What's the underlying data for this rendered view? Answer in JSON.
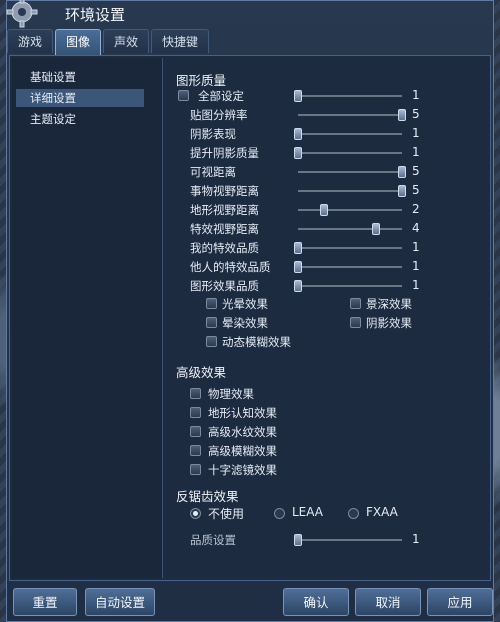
{
  "window": {
    "title": "环境设置"
  },
  "tabs": [
    {
      "label": "游戏",
      "active": false
    },
    {
      "label": "图像",
      "active": true
    },
    {
      "label": "声效",
      "active": false
    },
    {
      "label": "快捷键",
      "active": false
    }
  ],
  "sidebar": {
    "items": [
      {
        "label": "基础设置",
        "selected": false
      },
      {
        "label": "详细设置",
        "selected": true
      },
      {
        "label": "主题设定",
        "selected": false
      }
    ]
  },
  "graphics_quality": {
    "heading": "图形质量",
    "all_settings": {
      "label": "全部设定",
      "checked": false,
      "value": "1"
    },
    "sliders": [
      {
        "label": "贴图分辨率",
        "value": "5",
        "level": 1.0
      },
      {
        "label": "阴影表现",
        "value": "1",
        "level": 0.0
      },
      {
        "label": "提升阴影质量",
        "value": "1",
        "level": 0.0
      },
      {
        "label": "可视距离",
        "value": "5",
        "level": 1.0
      },
      {
        "label": "事物视野距离",
        "value": "5",
        "level": 1.0
      },
      {
        "label": "地形视野距离",
        "value": "2",
        "level": 0.25
      },
      {
        "label": "特效视野距离",
        "value": "4",
        "level": 0.75
      },
      {
        "label": "我的特效品质",
        "value": "1",
        "level": 0.0
      },
      {
        "label": "他人的特效品质",
        "value": "1",
        "level": 0.0
      },
      {
        "label": "图形效果品质",
        "value": "1",
        "level": 0.0
      }
    ],
    "effects": [
      {
        "label": "光晕效果",
        "checked": false
      },
      {
        "label": "景深效果",
        "checked": false
      },
      {
        "label": "晕染效果",
        "checked": false
      },
      {
        "label": "阴影效果",
        "checked": false
      },
      {
        "label": "动态模糊效果",
        "checked": false
      }
    ]
  },
  "advanced_effects": {
    "heading": "高级效果",
    "items": [
      {
        "label": "物理效果",
        "checked": false
      },
      {
        "label": "地形认知效果",
        "checked": false
      },
      {
        "label": "高级水纹效果",
        "checked": false
      },
      {
        "label": "高级模糊效果",
        "checked": false
      },
      {
        "label": "十字滤镜效果",
        "checked": false
      }
    ]
  },
  "antialiasing": {
    "heading": "反锯齿效果",
    "options": [
      {
        "label": "不使用",
        "selected": true
      },
      {
        "label": "LEAA",
        "selected": false
      },
      {
        "label": "FXAA",
        "selected": false
      }
    ],
    "quality": {
      "label": "品质设置",
      "value": "1",
      "level": 0.0
    }
  },
  "buttons": {
    "reset": "重置",
    "auto": "自动设置",
    "confirm": "确认",
    "cancel": "取消",
    "apply": "应用"
  }
}
